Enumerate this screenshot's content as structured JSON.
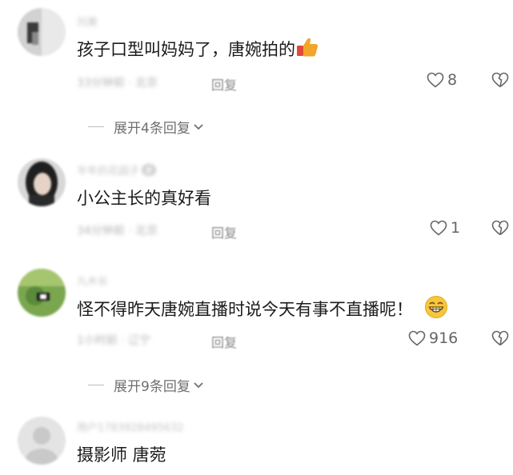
{
  "comments": [
    {
      "username": "刘美",
      "text": "孩子口型叫妈妈了，唐婉拍的",
      "time": "33分钟前 · 北京",
      "reply_label": "回复",
      "likes": "8",
      "emoji": "thumbs-up-icon"
    },
    {
      "username": "半年的花园子 💬",
      "text": "小公主长的真好看",
      "time": "34分钟前 · 北京",
      "reply_label": "回复",
      "likes": "1"
    },
    {
      "username": "九木长",
      "text": "怪不得昨天唐婉直播时说今天有事不直播呢！",
      "time": "1小时前 · 辽宁",
      "reply_label": "回复",
      "likes": "916",
      "emoji": "grinning-face-icon"
    },
    {
      "username": "用户1783928495632",
      "text": "摄影师 唐菀"
    }
  ],
  "expanders": [
    {
      "label": "展开4条回复"
    },
    {
      "label": "展开9条回复"
    }
  ],
  "colors": {
    "text": "#1b1b1b",
    "meta": "#9c9c9c",
    "icon": "#666666",
    "thumb": "#f2a52b"
  }
}
